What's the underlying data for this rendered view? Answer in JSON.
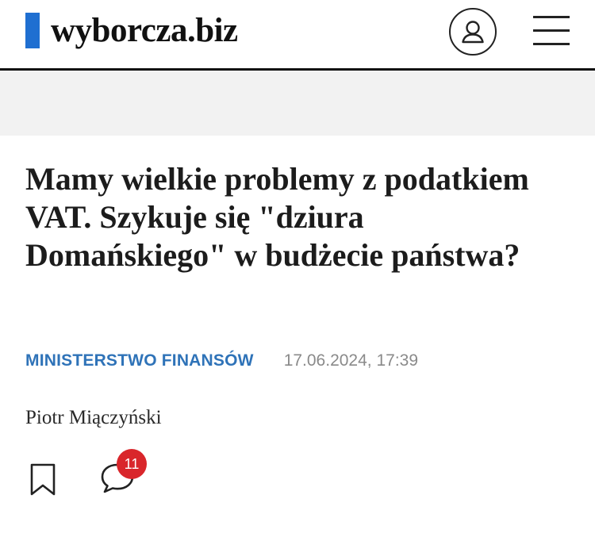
{
  "header": {
    "logo_text": "wyborcza.biz",
    "brand_color": "#1f6fd1",
    "account_icon": "user-icon",
    "menu_icon": "hamburger-menu-icon"
  },
  "article": {
    "headline": "Mamy wielkie problemy z podatkiem VAT. Szykuje się \"dziura Domańskiego\" w budżecie państwa?",
    "category": "MINISTERSTWO FINANSÓW",
    "category_color": "#2f73b8",
    "date": "17.06.2024, 17:39",
    "author": "Piotr Miączyński"
  },
  "actions": {
    "bookmark_icon": "bookmark-icon",
    "comments_icon": "comment-bubble-icon",
    "comments_count": "11",
    "badge_color": "#d9262b"
  }
}
